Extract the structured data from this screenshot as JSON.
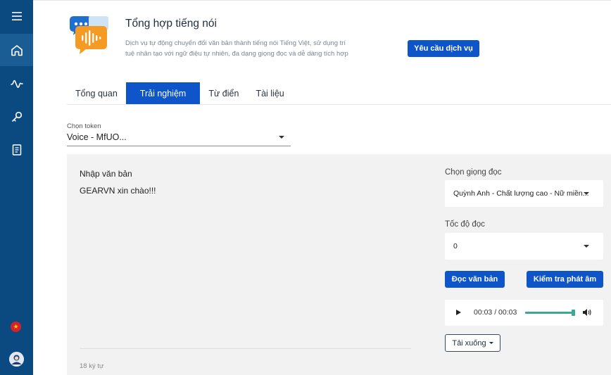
{
  "sidebar": {
    "items": [
      {
        "name": "menu-icon"
      },
      {
        "name": "home-icon"
      },
      {
        "name": "waveform-icon"
      },
      {
        "name": "key-icon"
      },
      {
        "name": "document-icon"
      }
    ],
    "flag_icon": "star",
    "colors": {
      "background": "#0a4a80",
      "active": "#1a5d95"
    }
  },
  "header": {
    "title": "Tổng hợp tiếng nói",
    "description": "Dịch vụ tự động chuyển đổi văn bản thành tiếng nói Tiếng Việt, sử dụng trí tuệ nhân tạo với ngữ điệu tự nhiên, đa dạng giọng đọc và dễ dàng tích hợp",
    "request_button": "Yêu cầu dịch vụ"
  },
  "tabs": [
    {
      "label": "Tổng quan",
      "active": false
    },
    {
      "label": "Trải nghiệm",
      "active": true
    },
    {
      "label": "Từ điển",
      "active": false
    },
    {
      "label": "Tài liệu",
      "active": false
    }
  ],
  "token": {
    "label": "Chọn token",
    "value": "Voice - MfUO..."
  },
  "editor": {
    "label": "Nhập văn bản",
    "text": "GEARVN xin chào!!!",
    "char_count": "18 ký tự"
  },
  "voice": {
    "label": "Chọn giọng đọc",
    "value": "Quỳnh Anh - Chất lượng cao - Nữ miền..."
  },
  "speed": {
    "label": "Tốc độ đọc",
    "value": "0"
  },
  "actions": {
    "read": "Đọc văn bản",
    "check": "Kiểm tra phát âm",
    "download": "Tải xuống"
  },
  "audio": {
    "time": "00:03 / 00:03",
    "progress": 1.0
  },
  "colors": {
    "primary": "#0d55c8",
    "panel": "#f2f2f2",
    "audio_progress": "#3aa897"
  }
}
